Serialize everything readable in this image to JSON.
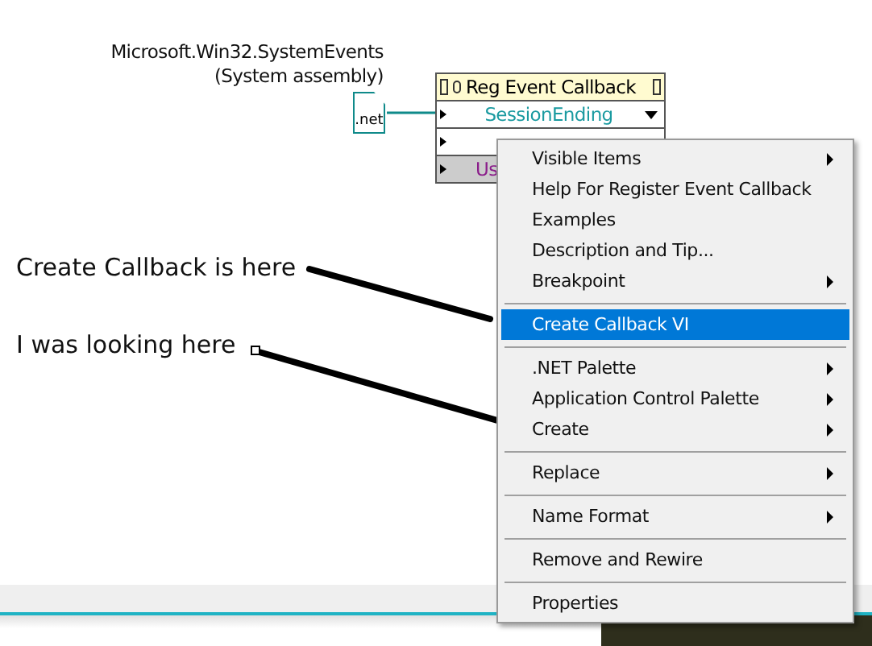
{
  "assembly_label": {
    "lines": [
      "Microsoft.Win32.SystemEvents",
      "(System assembly)"
    ]
  },
  "net_constant": {
    "text": ".net"
  },
  "node": {
    "title": "Reg Event Callback",
    "rows": [
      {
        "kind": "enum",
        "text": "SessionEnding"
      },
      {
        "kind": "ref"
      },
      {
        "kind": "user",
        "text": "Us"
      }
    ]
  },
  "annotations": [
    {
      "text": "Create Callback is here"
    },
    {
      "text": "I was looking here"
    }
  ],
  "context_menu": {
    "items": [
      {
        "kind": "item",
        "label": "Visible Items",
        "submenu": true,
        "selected": false
      },
      {
        "kind": "item",
        "label": "Help For Register Event Callback",
        "submenu": false,
        "selected": false
      },
      {
        "kind": "item",
        "label": "Examples",
        "submenu": false,
        "selected": false
      },
      {
        "kind": "item",
        "label": "Description and Tip...",
        "submenu": false,
        "selected": false
      },
      {
        "kind": "item",
        "label": "Breakpoint",
        "submenu": true,
        "selected": false
      },
      {
        "kind": "separator"
      },
      {
        "kind": "item",
        "label": "Create Callback VI",
        "submenu": false,
        "selected": true
      },
      {
        "kind": "separator"
      },
      {
        "kind": "item",
        "label": ".NET Palette",
        "submenu": true,
        "selected": false
      },
      {
        "kind": "item",
        "label": "Application Control Palette",
        "submenu": true,
        "selected": false
      },
      {
        "kind": "item",
        "label": "Create",
        "submenu": true,
        "selected": false
      },
      {
        "kind": "separator"
      },
      {
        "kind": "item",
        "label": "Replace",
        "submenu": true,
        "selected": false
      },
      {
        "kind": "separator"
      },
      {
        "kind": "item",
        "label": "Name Format",
        "submenu": true,
        "selected": false
      },
      {
        "kind": "separator"
      },
      {
        "kind": "item",
        "label": "Remove and Rewire",
        "submenu": false,
        "selected": false
      },
      {
        "kind": "separator"
      },
      {
        "kind": "item",
        "label": "Properties",
        "submenu": false,
        "selected": false
      }
    ]
  }
}
